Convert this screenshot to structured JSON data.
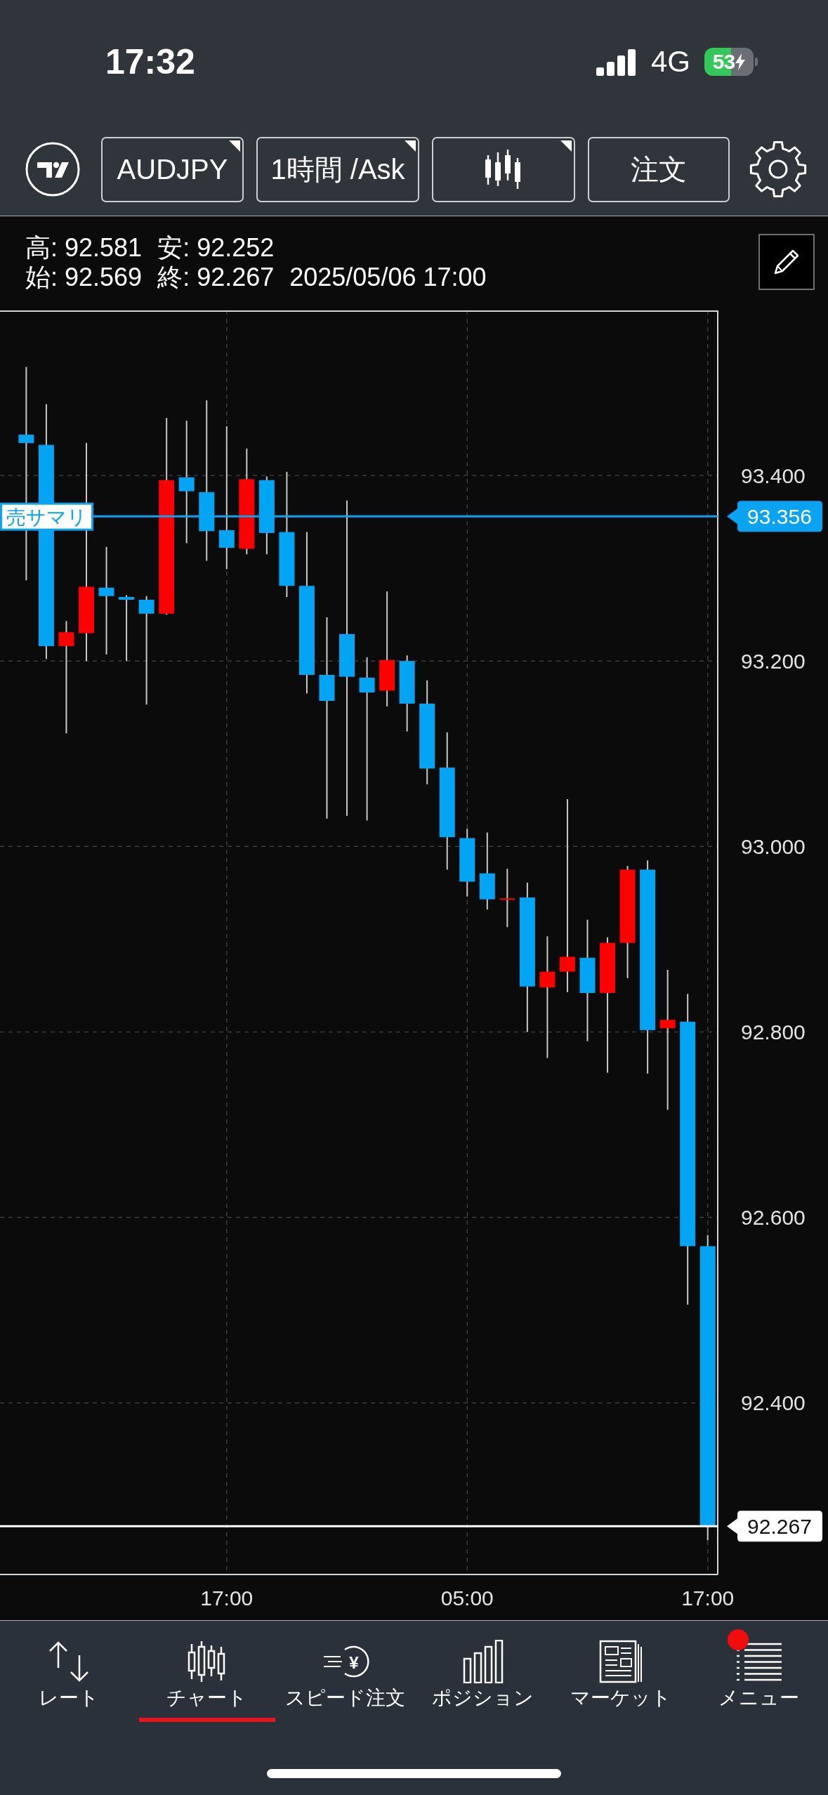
{
  "status_bar": {
    "time": "17:32",
    "network": "4G",
    "battery": "53",
    "charging": true
  },
  "toolbar": {
    "buttons": [
      {
        "kind": "symbol",
        "label": "AUDJPY",
        "dropdown": true
      },
      {
        "kind": "timeframe",
        "label": "1時間 /Ask",
        "dropdown": true
      },
      {
        "kind": "chart_type",
        "dropdown": true
      },
      {
        "kind": "order",
        "label": "注文",
        "dropdown": false
      }
    ]
  },
  "info": {
    "lines": [
      [
        "高: 92.581",
        "安: 92.252"
      ],
      [
        "始: 92.569",
        "終: 92.267",
        "2025/05/06 17:00"
      ]
    ]
  },
  "chart": {
    "chart_data": {
      "type": "candlestick",
      "grid": true,
      "categories": [
        null,
        null,
        null,
        null,
        null,
        null,
        null,
        null,
        null,
        null,
        "17:00",
        null,
        null,
        null,
        null,
        null,
        null,
        null,
        null,
        null,
        null,
        null,
        "05:00",
        null,
        null,
        null,
        null,
        null,
        null,
        null,
        null,
        null,
        null,
        null,
        "17:00"
      ],
      "series": [
        {
          "ohlc": [
            [
              93.444,
              93.517,
              93.287,
              93.435
            ],
            [
              93.433,
              93.477,
              93.202,
              93.216
            ],
            [
              93.216,
              93.243,
              93.122,
              93.231
            ],
            [
              93.23,
              93.435,
              93.2,
              93.28
            ],
            [
              93.279,
              93.323,
              93.207,
              93.27
            ],
            [
              93.269,
              93.271,
              93.2,
              93.266
            ],
            [
              93.266,
              93.27,
              93.153,
              93.251
            ],
            [
              93.251,
              93.462,
              93.25,
              93.395
            ],
            [
              93.398,
              93.459,
              93.327,
              93.383
            ],
            [
              93.382,
              93.481,
              93.308,
              93.34
            ],
            [
              93.341,
              93.453,
              93.299,
              93.322
            ],
            [
              93.321,
              93.429,
              93.315,
              93.396
            ],
            [
              93.395,
              93.399,
              93.315,
              93.338
            ],
            [
              93.339,
              93.404,
              93.269,
              93.281
            ],
            [
              93.281,
              93.339,
              93.165,
              93.185
            ],
            [
              93.185,
              93.247,
              93.03,
              93.157
            ],
            [
              93.229,
              93.373,
              93.033,
              93.183
            ],
            [
              93.182,
              93.204,
              93.028,
              93.166
            ],
            [
              93.168,
              93.275,
              93.151,
              93.201
            ],
            [
              93.2,
              93.206,
              93.124,
              93.154
            ],
            [
              93.154,
              93.179,
              93.067,
              93.084
            ],
            [
              93.085,
              93.123,
              92.975,
              93.01
            ],
            [
              93.009,
              93.019,
              92.946,
              92.962
            ],
            [
              92.971,
              93.015,
              92.932,
              92.943
            ],
            [
              92.944,
              92.976,
              92.913,
              92.944
            ],
            [
              92.945,
              92.961,
              92.8,
              92.849
            ],
            [
              92.848,
              92.903,
              92.772,
              92.865
            ],
            [
              92.865,
              93.051,
              92.843,
              92.881
            ],
            [
              92.88,
              92.921,
              92.79,
              92.842
            ],
            [
              92.842,
              92.902,
              92.756,
              92.896
            ],
            [
              92.896,
              92.979,
              92.858,
              92.975
            ],
            [
              92.975,
              92.985,
              92.755,
              92.802
            ],
            [
              92.804,
              92.867,
              92.716,
              92.813
            ],
            [
              92.811,
              92.841,
              92.506,
              92.569
            ],
            [
              92.569,
              92.581,
              92.252,
              92.267
            ]
          ]
        }
      ],
      "ylim": [
        92.215,
        93.578
      ],
      "yticks": [
        {
          "value": 93.4,
          "label": "93.400"
        },
        {
          "value": 93.2,
          "label": "93.200"
        },
        {
          "value": 93.0,
          "label": "93.000"
        },
        {
          "value": 92.8,
          "label": "92.800"
        },
        {
          "value": 92.6,
          "label": "92.600"
        },
        {
          "value": 92.4,
          "label": "92.400"
        }
      ],
      "ref_lines": [
        {
          "axis": "y",
          "value": 93.356,
          "label": "売サマリ",
          "color": "#0aa3f2"
        },
        {
          "axis": "y",
          "value": 92.267,
          "color": "#ffffff"
        }
      ]
    },
    "price_tags": [
      {
        "text": "93.356",
        "color": "#0aa3f2"
      },
      {
        "text": "92.267",
        "color": "#ffffff"
      }
    ]
  },
  "nav": {
    "items": [
      {
        "kind": "rate",
        "label": "レート",
        "selected": false,
        "notification": false
      },
      {
        "kind": "chart",
        "label": "チャート",
        "selected": true,
        "notification": false
      },
      {
        "kind": "speed_order",
        "label": "スピード注文",
        "symbol": "¥",
        "selected": false,
        "notification": false
      },
      {
        "kind": "positions",
        "label": "ポジション",
        "selected": false,
        "notification": false
      },
      {
        "kind": "market",
        "label": "マーケット",
        "selected": false,
        "notification": false
      },
      {
        "kind": "menu",
        "label": "メニュー",
        "selected": false,
        "notification": true
      }
    ]
  }
}
